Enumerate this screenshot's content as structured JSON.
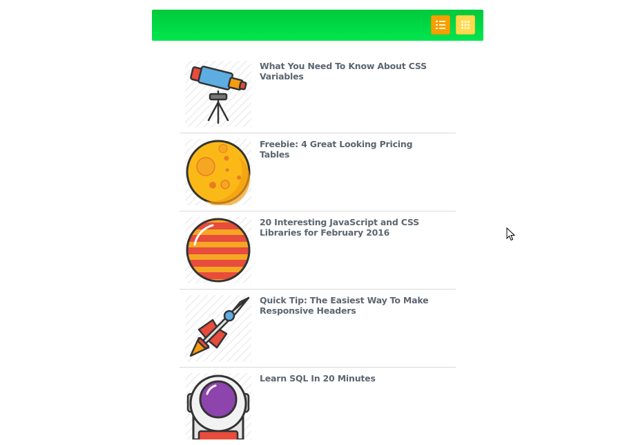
{
  "toolbar": {
    "list_view_icon": "list-icon",
    "grid_view_icon": "grid-icon",
    "colors": {
      "bar": "#00d944",
      "list_button": "#f5a000",
      "grid_button": "#ffd94d"
    }
  },
  "articles": [
    {
      "title": "What You Need To Know About CSS Variables",
      "icon": "telescope-icon"
    },
    {
      "title": "Freebie: 4 Great Looking Pricing Tables",
      "icon": "moon-icon"
    },
    {
      "title": "20 Interesting JavaScript and CSS Libraries for February 2016",
      "icon": "planet-icon"
    },
    {
      "title": "Quick Tip: The Easiest Way To Make Responsive Headers",
      "icon": "rocket-icon"
    },
    {
      "title": "Learn SQL In 20 Minutes",
      "icon": "astronaut-icon"
    }
  ]
}
